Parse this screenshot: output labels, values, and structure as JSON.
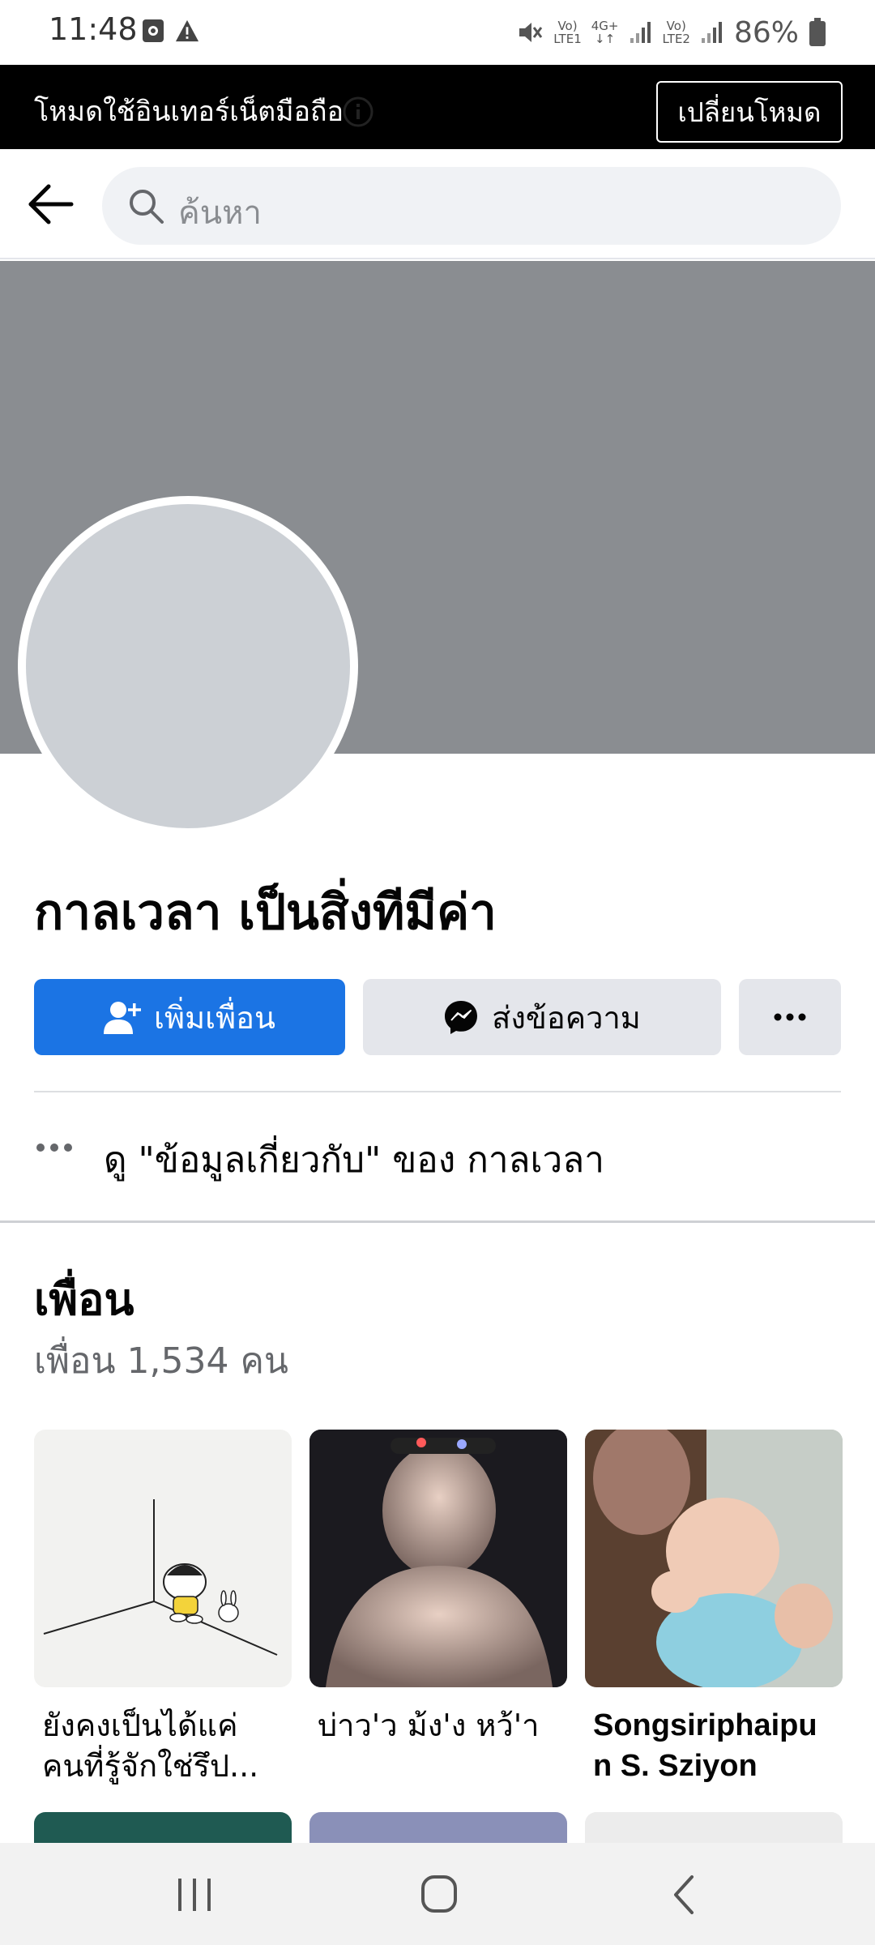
{
  "status_bar": {
    "time": "11:48",
    "net1_top": "Vo)",
    "net1_bottom": "LTE1",
    "net2_top": "4G+",
    "net3_top": "Vo)",
    "net3_bottom": "LTE2",
    "battery": "86%"
  },
  "mode_banner": {
    "text": "โหมดใช้อินเทอร์เน็ตมือถือ",
    "button_label": "เปลี่ยนโหมด"
  },
  "search": {
    "placeholder": "ค้นหา"
  },
  "profile": {
    "name": "กาลเวลา เป็นสิ่งทีมีค่า"
  },
  "actions": {
    "add_friend": "เพิ่มเพื่อน",
    "message": "ส่งข้อความ"
  },
  "about": {
    "text": "ดู \"ข้อมูลเกี่ยวกับ\" ของ กาลเวลา"
  },
  "friends": {
    "title": "เพื่อน",
    "count": "เพื่อน 1,534 คน",
    "items": [
      {
        "name_line1": "ยังคงเป็นได้แค่",
        "name_line2": "คนที่รู้จักใช่รึป..."
      },
      {
        "name_line1": "บ่าว'ว ม้ง'ง หว้'า",
        "name_line2": ""
      },
      {
        "name_line1": "Songsiriphaipu",
        "name_line2": "n S. Sziyon"
      }
    ]
  },
  "colors": {
    "accent": "#1b74e4",
    "cover": "#8a8d91",
    "avatar": "#ccd0d5"
  }
}
